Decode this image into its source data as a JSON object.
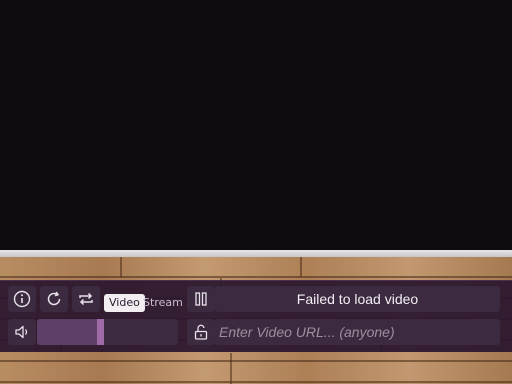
{
  "player": {
    "status_text": "Failed to load video",
    "mode_tabs": [
      "Video",
      "Stream"
    ],
    "selected_mode": "Video",
    "url_placeholder": "Enter Video URL... (anyone)",
    "url_value": "",
    "volume": 0.45
  },
  "icons": {
    "info": "info-icon",
    "reload": "reload-icon",
    "loop": "loop-icon",
    "pause": "pause-icon",
    "volume": "volume-icon",
    "lock": "unlock-icon"
  },
  "colors": {
    "panel": "#2a162e",
    "button": "#3b2a40",
    "accent": "#a06aa9",
    "text": "#f3eff3"
  }
}
